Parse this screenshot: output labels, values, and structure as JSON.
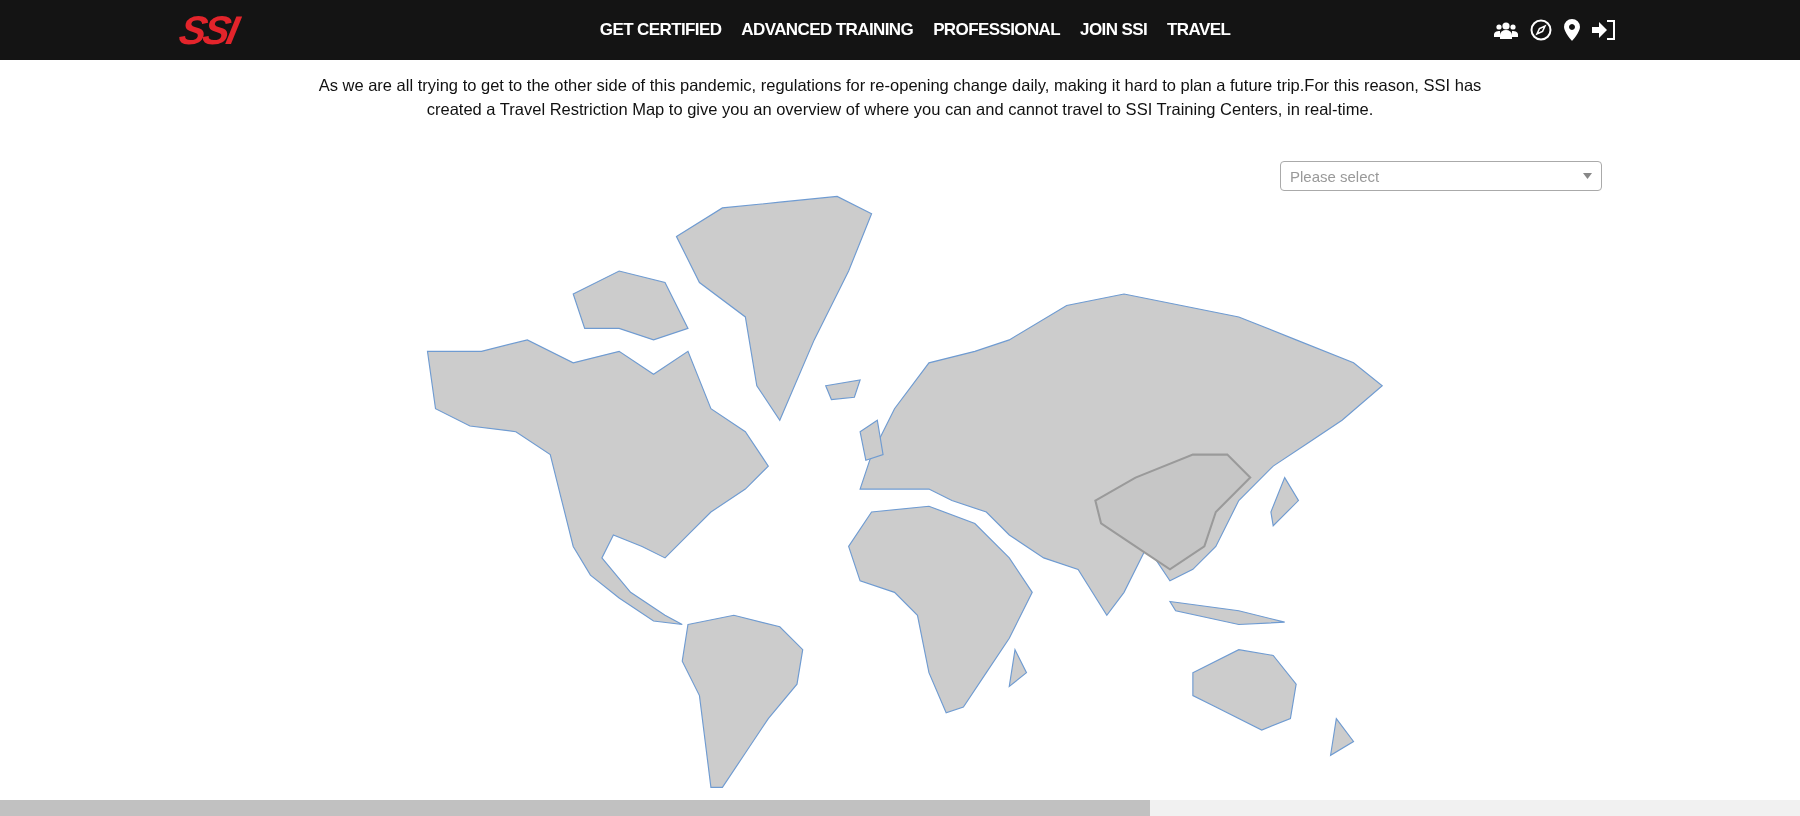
{
  "header": {
    "logo": "SSI",
    "nav": [
      {
        "label": "GET CERTIFIED"
      },
      {
        "label": "ADVANCED TRAINING"
      },
      {
        "label": "PROFESSIONAL"
      },
      {
        "label": "JOIN SSI"
      },
      {
        "label": "TRAVEL"
      }
    ]
  },
  "intro": "As we are all trying to get to the other side of this pandemic, regulations for re-opening change daily, making it hard to plan a future trip.For this reason, SSI has created a Travel Restriction Map to give you an overview of where you can and cannot travel to SSI Training Centers, in real-time.",
  "country_select": {
    "placeholder": "Please select"
  }
}
